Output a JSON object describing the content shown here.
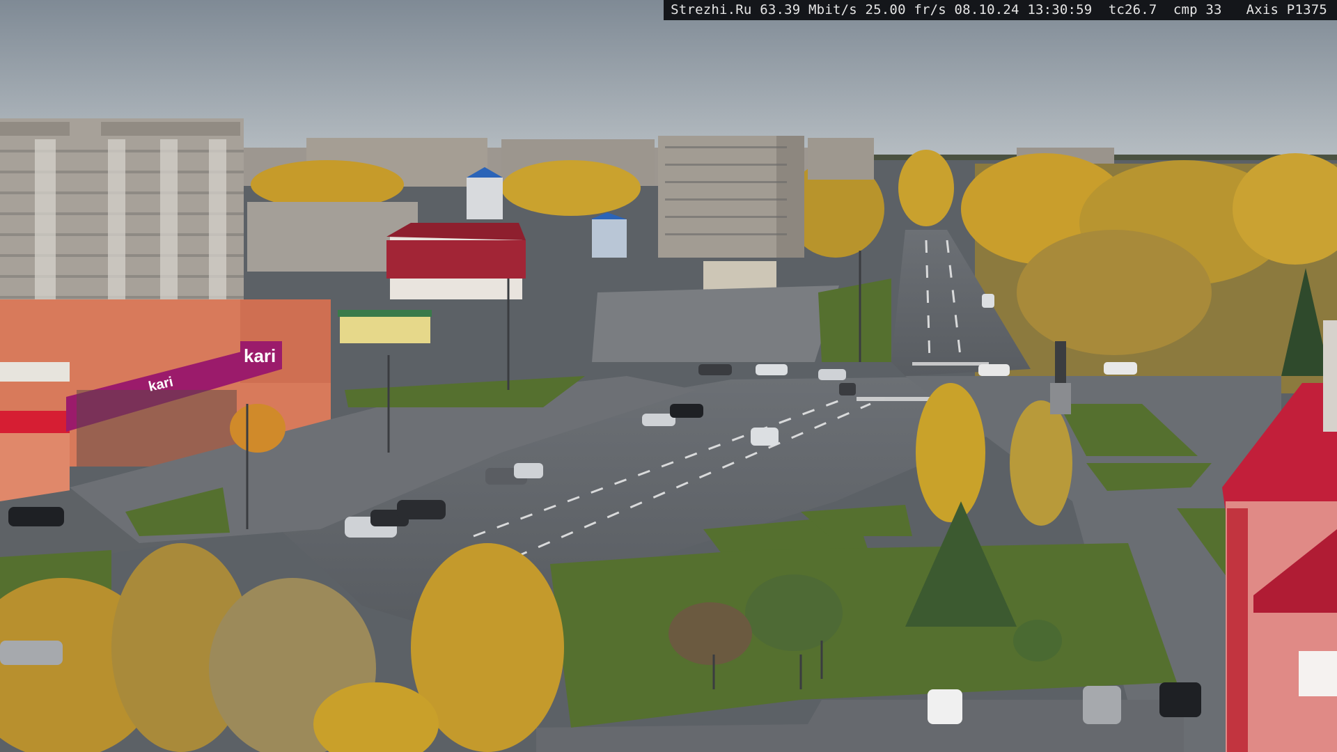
{
  "osd": {
    "site": "Strezhi.Ru",
    "bitrate": "63.39 Mbit/s",
    "framerate": "25.00 fr/s",
    "date": "08.10.24",
    "time": "13:30:59",
    "tc": "tc26.7",
    "cmp": "cmp 33",
    "camera": "Axis P1375"
  },
  "signs": {
    "store_logo": "kari",
    "store_banner": "kari"
  },
  "colors": {
    "sky": "#9aa6b1",
    "asphalt": "#5f6368",
    "grass": "#4f6b2e",
    "autumn_foliage": "#c9a22a",
    "store_facade": "#d97a5a",
    "brand_magenta": "#9b1b6b",
    "red_roof": "#c21f3a"
  }
}
